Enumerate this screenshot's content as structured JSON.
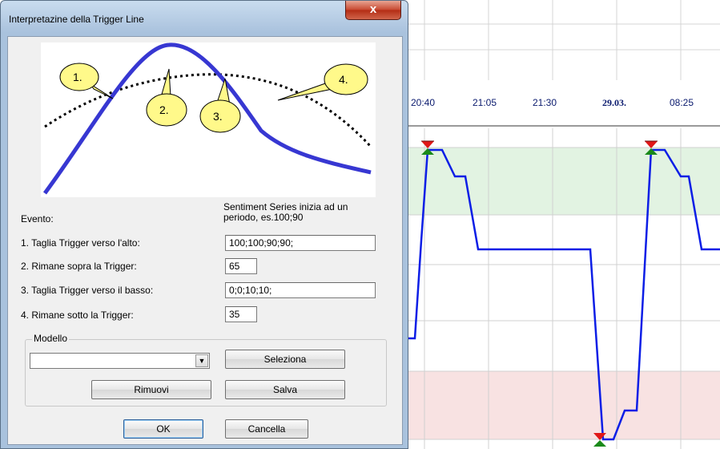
{
  "dialog": {
    "title": "Interpretazine della Trigger Line",
    "close_glyph": "x",
    "callouts": [
      "1.",
      "2.",
      "3.",
      "4."
    ],
    "note": "Sentiment Series inizia ad un periodo, es.100;90",
    "event_header": "Evento:",
    "fields": [
      {
        "label": "1. Taglia Trigger verso l'alto:",
        "value": "100;100;90;90;"
      },
      {
        "label": "2. Rimane sopra la Trigger:",
        "value": "65"
      },
      {
        "label": "3. Taglia Trigger verso il basso:",
        "value": "0;0;10;10;"
      },
      {
        "label": "4. Rimane sotto la Trigger:",
        "value": "35"
      }
    ],
    "model_group": {
      "label": "Modello",
      "selected": "",
      "select_label": "Seleziona",
      "remove_label": "Rimuovi",
      "save_label": "Salva"
    },
    "ok_label": "OK",
    "cancel_label": "Cancella"
  },
  "chart": {
    "time_labels": [
      "20:40",
      "21:05",
      "21:30",
      "29.03.",
      "08:25"
    ],
    "bold_label_index": 3,
    "colors": {
      "line": "#0c1ee6",
      "upper_zone": "#e2f3e2",
      "lower_zone": "#f8e2e2",
      "marker_sell": "#e01818",
      "marker_buy": "#1a8a1a"
    }
  }
}
